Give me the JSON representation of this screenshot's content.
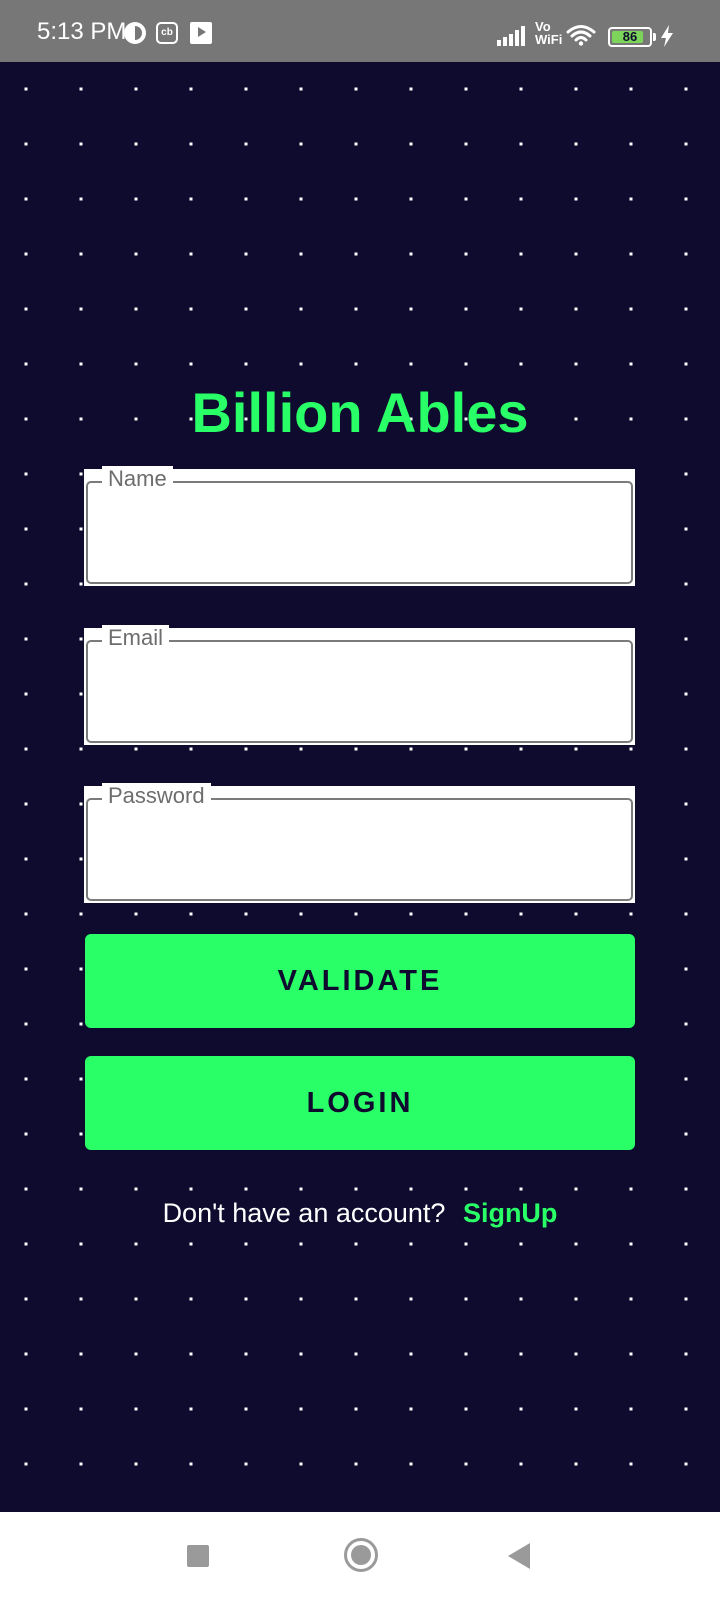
{
  "status_bar": {
    "time": "5:13 PM",
    "cb_label": "cb",
    "vo_label": "Vo",
    "wifi_label": "WiFi",
    "battery_percent": "86",
    "battery_level": 0.86,
    "background_color": "#777777"
  },
  "app": {
    "title": "Billion Ables",
    "accent_color": "#29ff66",
    "background_color": "#0e0b2e"
  },
  "form": {
    "name_label": "Name",
    "name_value": "",
    "email_label": "Email",
    "email_value": "",
    "password_label": "Password",
    "password_value": ""
  },
  "buttons": {
    "validate_label": "VALIDATE",
    "login_label": "LOGIN"
  },
  "signup": {
    "prompt": "Don't have an account?",
    "link_label": "SignUp"
  },
  "nav_bar": {
    "icons": [
      "recents-icon",
      "home-icon",
      "back-icon"
    ]
  }
}
